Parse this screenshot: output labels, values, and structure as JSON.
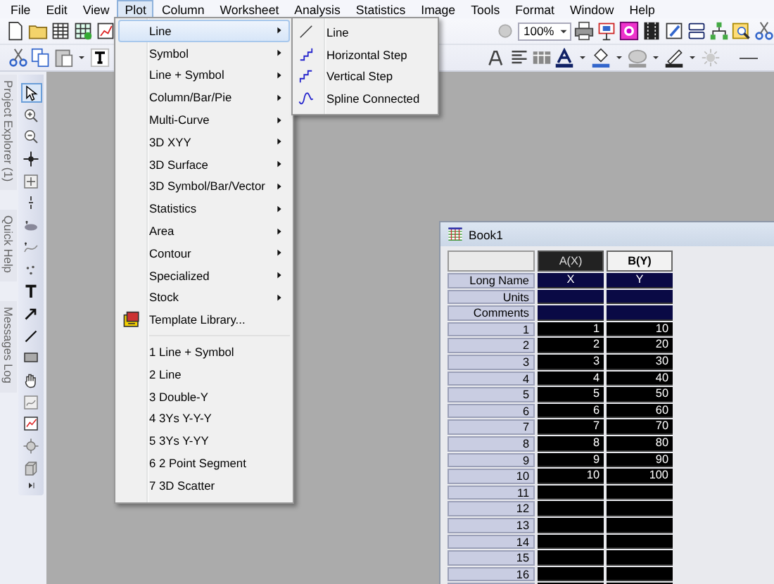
{
  "menubar": {
    "items": [
      {
        "label": "File",
        "selected": false
      },
      {
        "label": "Edit",
        "selected": false
      },
      {
        "label": "View",
        "selected": false
      },
      {
        "label": "Plot",
        "selected": true
      },
      {
        "label": "Column",
        "selected": false
      },
      {
        "label": "Worksheet",
        "selected": false
      },
      {
        "label": "Analysis",
        "selected": false
      },
      {
        "label": "Statistics",
        "selected": false
      },
      {
        "label": "Image",
        "selected": false
      },
      {
        "label": "Tools",
        "selected": false
      },
      {
        "label": "Format",
        "selected": false
      },
      {
        "label": "Window",
        "selected": false
      },
      {
        "label": "Help",
        "selected": false
      }
    ]
  },
  "toolbar": {
    "zoom": "100%"
  },
  "dock_tabs": [
    {
      "label": "Project Explorer (1)"
    },
    {
      "label": "Quick Help"
    },
    {
      "label": "Messages Log"
    }
  ],
  "tools": [
    {
      "selected": true
    },
    {
      "selected": false
    },
    {
      "selected": false
    },
    {
      "selected": false
    },
    {
      "selected": false
    },
    {
      "selected": false
    },
    {
      "selected": false
    },
    {
      "selected": false
    },
    {
      "selected": false
    },
    {
      "selected": false
    },
    {
      "selected": false
    },
    {
      "selected": false
    },
    {
      "selected": false
    },
    {
      "selected": false
    },
    {
      "selected": false
    },
    {
      "selected": false
    },
    {
      "selected": false
    },
    {
      "selected": false
    }
  ],
  "plot_menu": {
    "items": [
      {
        "label": "Line",
        "kind": "submenu",
        "selected": true
      },
      {
        "label": "Symbol",
        "kind": "submenu",
        "selected": false
      },
      {
        "label": "Line + Symbol",
        "kind": "submenu",
        "selected": false
      },
      {
        "label": "Column/Bar/Pie",
        "kind": "submenu",
        "selected": false
      },
      {
        "label": "Multi-Curve",
        "kind": "submenu",
        "selected": false
      },
      {
        "label": "3D XYY",
        "kind": "submenu",
        "selected": false
      },
      {
        "label": "3D Surface",
        "kind": "submenu",
        "selected": false
      },
      {
        "label": "3D Symbol/Bar/Vector",
        "kind": "submenu",
        "selected": false
      },
      {
        "label": "Statistics",
        "kind": "submenu",
        "selected": false
      },
      {
        "label": "Area",
        "kind": "submenu",
        "selected": false
      },
      {
        "label": "Contour",
        "kind": "submenu",
        "selected": false
      },
      {
        "label": "Specialized",
        "kind": "submenu",
        "selected": false
      },
      {
        "label": "Stock",
        "kind": "submenu",
        "selected": false
      },
      {
        "label": "Template Library...",
        "kind": "command",
        "selected": false
      }
    ],
    "recent": [
      {
        "label": "1 Line + Symbol"
      },
      {
        "label": "2 Line"
      },
      {
        "label": "3 Double-Y"
      },
      {
        "label": "4 3Ys Y-Y-Y"
      },
      {
        "label": "5 3Ys Y-YY"
      },
      {
        "label": "6 2 Point Segment"
      },
      {
        "label": "7 3D Scatter"
      }
    ]
  },
  "line_submenu": {
    "items": [
      {
        "label": "Line"
      },
      {
        "label": "Horizontal Step"
      },
      {
        "label": "Vertical Step"
      },
      {
        "label": "Spline Connected"
      }
    ]
  },
  "book": {
    "title": "Book1",
    "columns": [
      {
        "label": "A(X)",
        "active": false
      },
      {
        "label": "B(Y)",
        "active": true
      }
    ],
    "label_rows": [
      {
        "label": "Long Name",
        "values": [
          "X",
          "Y"
        ]
      },
      {
        "label": "Units"
      },
      {
        "label": "Comments"
      }
    ],
    "rows": [
      {
        "label": "1",
        "values": [
          "1",
          "10"
        ]
      },
      {
        "label": "2",
        "values": [
          "2",
          "20"
        ]
      },
      {
        "label": "3",
        "values": [
          "3",
          "30"
        ]
      },
      {
        "label": "4",
        "values": [
          "4",
          "40"
        ]
      },
      {
        "label": "5",
        "values": [
          "5",
          "50"
        ]
      },
      {
        "label": "6",
        "values": [
          "6",
          "60"
        ]
      },
      {
        "label": "7",
        "values": [
          "7",
          "70"
        ]
      },
      {
        "label": "8",
        "values": [
          "8",
          "80"
        ]
      },
      {
        "label": "9",
        "values": [
          "9",
          "90"
        ]
      },
      {
        "label": "10",
        "values": [
          "10",
          "100"
        ]
      },
      {
        "label": "11"
      },
      {
        "label": "12"
      },
      {
        "label": "13"
      },
      {
        "label": "14"
      },
      {
        "label": "15"
      },
      {
        "label": "16"
      }
    ]
  }
}
